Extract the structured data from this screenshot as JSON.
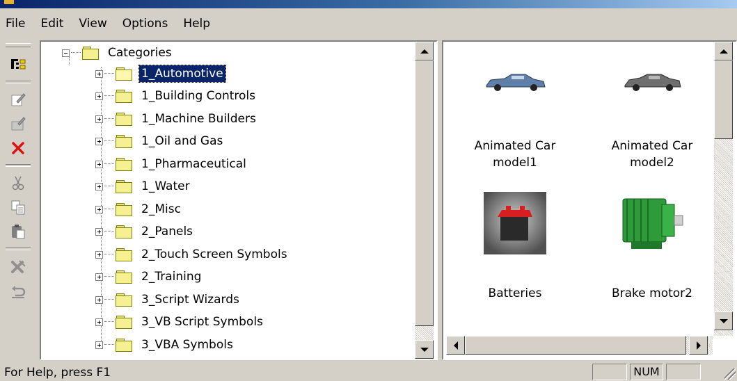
{
  "menu": [
    "File",
    "Edit",
    "View",
    "Options",
    "Help"
  ],
  "toolbar": {
    "buttons": [
      {
        "icon": "tree-view-icon"
      },
      {
        "icon": "edit-properties-icon"
      },
      {
        "icon": "new-item-icon"
      },
      {
        "icon": "delete-icon",
        "color": "#e01010"
      },
      {
        "icon": "cut-icon"
      },
      {
        "icon": "copy-icon"
      },
      {
        "icon": "paste-icon"
      },
      {
        "icon": "disconnect-icon"
      },
      {
        "icon": "undo-icon"
      }
    ]
  },
  "tree": {
    "root": "Categories",
    "selected": "1_Automotive",
    "items": [
      "1_Automotive",
      "1_Building Controls",
      "1_Machine Builders",
      "1_Oil and Gas",
      "1_Pharmaceutical",
      "1_Water",
      "2_Misc",
      "2_Panels",
      "2_Touch Screen Symbols",
      "2_Training",
      "3_Script Wizards",
      "3_VB Script Symbols",
      "3_VBA Symbols"
    ]
  },
  "symbols": {
    "items": [
      {
        "line1": "Animated Car",
        "line2": "model1",
        "icon": "blue-car-icon"
      },
      {
        "line1": "Animated Car",
        "line2": "model2",
        "icon": "gray-car-icon"
      },
      {
        "line1": "Batteries",
        "line2": "",
        "icon": "battery-icon"
      },
      {
        "line1": "Brake motor2",
        "line2": "",
        "icon": "brake-motor-icon"
      }
    ]
  },
  "status": {
    "help_text": "For Help, press F1",
    "num": "NUM"
  },
  "colors": {
    "selection": "#0a246a",
    "chrome": "#d4d0c8",
    "folder": "#f5f092"
  }
}
